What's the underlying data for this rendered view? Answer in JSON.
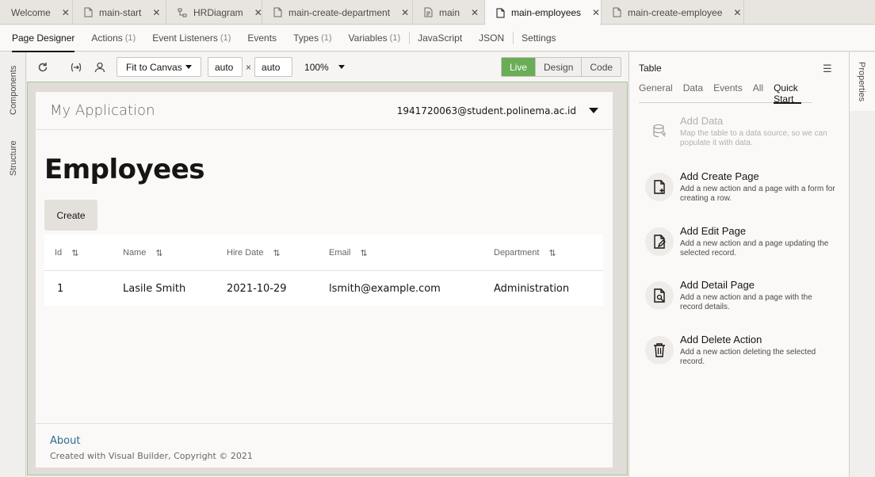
{
  "editor_tabs": [
    {
      "label": "Welcome",
      "icon": "none",
      "active": false
    },
    {
      "label": "main-start",
      "icon": "file-icon",
      "active": false
    },
    {
      "label": "HRDiagram",
      "icon": "diagram-icon",
      "active": false
    },
    {
      "label": "main-create-department",
      "icon": "file-icon",
      "active": false
    },
    {
      "label": "main",
      "icon": "flow-icon",
      "active": false
    },
    {
      "label": "main-employees",
      "icon": "file-icon",
      "active": true
    },
    {
      "label": "main-create-employee",
      "icon": "file-icon",
      "active": false
    }
  ],
  "sub_tabs": {
    "page_designer": "Page Designer",
    "actions": "Actions",
    "actions_count": "(1)",
    "event_listeners": "Event Listeners",
    "event_listeners_count": "(1)",
    "events": "Events",
    "types": "Types",
    "types_count": "(1)",
    "variables": "Variables",
    "variables_count": "(1)",
    "javascript": "JavaScript",
    "json": "JSON",
    "settings": "Settings"
  },
  "left_rail": {
    "components": "Components",
    "structure": "Structure"
  },
  "toolbar": {
    "fit_select": "Fit to Canvas",
    "width_value": "auto",
    "times": "×",
    "height_value": "auto",
    "zoom": "100%",
    "modes": {
      "live": "Live",
      "design": "Design",
      "code": "Code"
    },
    "active_mode": "Live"
  },
  "app": {
    "title": "My Application",
    "user": "1941720063@student.polinema.ac.id",
    "heading": "Employees",
    "create_button": "Create",
    "table": {
      "columns": [
        "Id",
        "Name",
        "Hire Date",
        "Email",
        "Department"
      ],
      "rows": [
        [
          "1",
          "Lasile Smith",
          "2021-10-29",
          "lsmith@example.com",
          "Administration"
        ]
      ]
    },
    "footer": {
      "about": "About",
      "copyright": "Created with Visual Builder, Copyright © 2021"
    }
  },
  "properties": {
    "title": "Table",
    "tabs": [
      "General",
      "Data",
      "Events",
      "All",
      "Quick Start"
    ],
    "active_tab": "Quick Start",
    "quick_start": [
      {
        "title": "Add Data",
        "desc": "Map the table to a data source, so we can populate it with data.",
        "icon": "database-icon",
        "disabled": true
      },
      {
        "title": "Add Create Page",
        "desc": "Add a new action and a page with a form for creating a row.",
        "icon": "file-plus-icon",
        "disabled": false
      },
      {
        "title": "Add Edit Page",
        "desc": "Add a new action and a page updating the selected record.",
        "icon": "file-edit-icon",
        "disabled": false
      },
      {
        "title": "Add Detail Page",
        "desc": "Add a new action and a page with the record details.",
        "icon": "file-search-icon",
        "disabled": false
      },
      {
        "title": "Add Delete Action",
        "desc": "Add a new action deleting the selected record.",
        "icon": "trash-icon",
        "disabled": false
      }
    ]
  },
  "right_rail": {
    "properties": "Properties"
  },
  "colors": {
    "accent_live": "#6bac56",
    "link": "#2f6c8f",
    "canvas_border": "#a4c794"
  }
}
